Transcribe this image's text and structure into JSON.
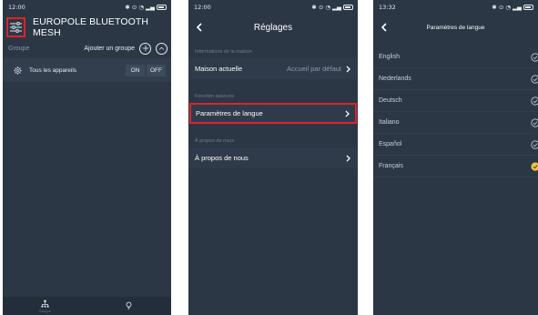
{
  "colors": {
    "background": "#2b3745",
    "highlight_border": "#e0222a",
    "selected_check": "#f5c23b",
    "muted_text": "#8a96a4"
  },
  "screen1": {
    "status": {
      "time": "12:00",
      "icons": "✱ ☉ ◷ ̶‥‥‥"
    },
    "app_title": "EUROPOLE BLUETOOTH MESH",
    "group_label": "Groupe",
    "add_group_label": "Ajouter un groupe",
    "device_row": {
      "label": "Tous les appareils",
      "on_label": "ON",
      "off_label": "OFF"
    },
    "bottom_nav": [
      {
        "icon": "network-icon",
        "label": "Groupe"
      },
      {
        "icon": "bulb-icon",
        "label": ""
      }
    ]
  },
  "screen2": {
    "status": {
      "time": "12:00"
    },
    "title": "Réglages",
    "sections": [
      {
        "header": "Informations de la maison",
        "row_label": "Maison actuelle",
        "row_value": "Accueil par défaut"
      },
      {
        "header": "Fonction avancée",
        "row_label": "Paramètres de langue",
        "row_value": ""
      },
      {
        "header": "À propos de nous",
        "row_label": "À propos de nous",
        "row_value": ""
      }
    ]
  },
  "screen3": {
    "status": {
      "time": "13:32"
    },
    "title": "Paramètres de langue",
    "languages": [
      {
        "label": "English",
        "selected": false
      },
      {
        "label": "Nederlands",
        "selected": false
      },
      {
        "label": "Deutsch",
        "selected": false
      },
      {
        "label": "Italiano",
        "selected": false
      },
      {
        "label": "Español",
        "selected": false
      },
      {
        "label": "Français",
        "selected": true
      }
    ]
  }
}
